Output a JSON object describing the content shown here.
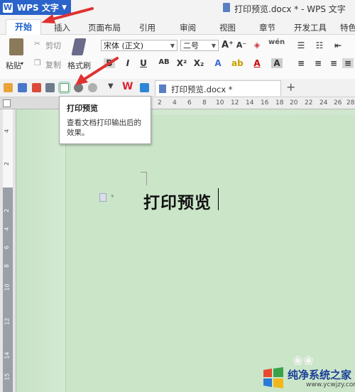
{
  "app": {
    "button_label": "WPS 文字",
    "logo_letter": "W"
  },
  "window": {
    "title": "打印预览.docx * - WPS 文字"
  },
  "ribbon_tabs": [
    "开始",
    "插入",
    "页面布局",
    "引用",
    "审阅",
    "视图",
    "章节",
    "开发工具",
    "特色"
  ],
  "clipboard": {
    "paste": "粘贴",
    "cut": "剪切",
    "copy": "复制",
    "format_painter": "格式刷"
  },
  "font": {
    "name": "宋体 (正文)",
    "size": "二号"
  },
  "document_tab": {
    "name": "打印预览.docx *"
  },
  "ruler_top_numbers": [
    "2",
    "4",
    "6",
    "8",
    "10",
    "12",
    "14",
    "16",
    "18",
    "20",
    "22",
    "24",
    "26",
    "28"
  ],
  "ruler_left_numbers": [
    "4",
    "2",
    "2",
    "4",
    "6",
    "8",
    "10",
    "12",
    "14",
    "15"
  ],
  "tooltip": {
    "title": "打印预览",
    "body": "查看文档打印输出后的效果。"
  },
  "document": {
    "heading": "打印预览"
  },
  "watermark": {
    "text": "纯净系统之家",
    "url": "www.ycwjzy.com"
  },
  "colors": {
    "accent": "#2a63c9",
    "arrow": "#e03131",
    "canvas": "#cfe6cf"
  }
}
